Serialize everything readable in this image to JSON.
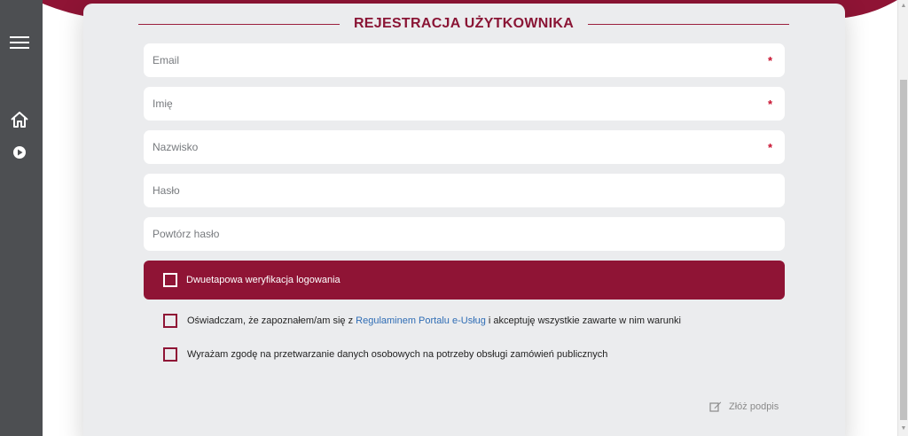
{
  "sidebar": {
    "icons": [
      "hamburger-menu-icon",
      "home-icon",
      "play-circle-icon"
    ],
    "bg": "#4d4f52"
  },
  "form": {
    "title": "REJESTRACJA UŻYTKOWNIKA",
    "fields": [
      {
        "placeholder": "Email",
        "required_mark": "*"
      },
      {
        "placeholder": "Imię",
        "required_mark": "*"
      },
      {
        "placeholder": "Nazwisko",
        "required_mark": "*"
      },
      {
        "placeholder": "Hasło",
        "required_mark": ""
      },
      {
        "placeholder": "Powtórz hasło",
        "required_mark": ""
      }
    ],
    "two_step_label": "Dwuetapowa weryfikacja logowania",
    "consent1": {
      "before": "Oświadczam, że zapoznałem/am się z ",
      "link": "Regulaminem Portalu e-Usług",
      "after": " i akceptuję wszystkie zawarte w nim warunki"
    },
    "consent2": "Wyrażam zgodę na przetwarzanie danych osobowych na potrzeby obsługi zamówień publicznych",
    "sign_label": "Złóż podpis"
  },
  "colors": {
    "accent": "#8f1435",
    "link": "#2f6db5",
    "card_bg": "#ebecee"
  }
}
